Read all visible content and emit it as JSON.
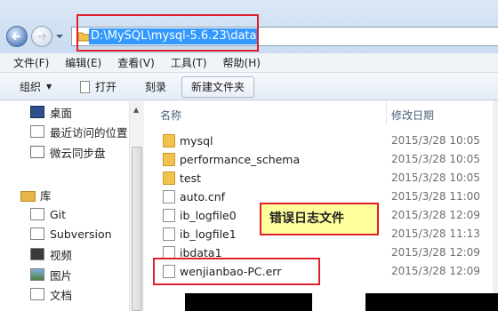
{
  "address": {
    "path": "D:\\MySQL\\mysql-5.6.23\\data"
  },
  "menu": [
    "文件(F)",
    "编辑(E)",
    "查看(V)",
    "工具(T)",
    "帮助(H)"
  ],
  "toolbar": {
    "organize": "组织",
    "open": "打开",
    "burn": "刻录",
    "new_folder": "新建文件夹"
  },
  "nav": {
    "favorites": [
      {
        "label": "桌面",
        "icon": "desktop-icon"
      },
      {
        "label": "最近访问的位置",
        "icon": "recent-places-icon"
      },
      {
        "label": "微云同步盘",
        "icon": "weiyun-sync-icon"
      }
    ],
    "libraries_label": "库",
    "libraries": [
      {
        "label": "Git",
        "icon": "git-library-icon"
      },
      {
        "label": "Subversion",
        "icon": "svn-library-icon"
      },
      {
        "label": "视频",
        "icon": "video-library-icon"
      },
      {
        "label": "图片",
        "icon": "picture-library-icon"
      },
      {
        "label": "文档",
        "icon": "document-library-icon"
      }
    ]
  },
  "columns": {
    "name": "名称",
    "modified": "修改日期"
  },
  "files": [
    {
      "name": "mysql",
      "date": "2015/3/28 10:05",
      "kind": "folder"
    },
    {
      "name": "performance_schema",
      "date": "2015/3/28 10:05",
      "kind": "folder"
    },
    {
      "name": "test",
      "date": "2015/3/28 10:05",
      "kind": "folder"
    },
    {
      "name": "auto.cnf",
      "date": "2015/3/28 11:00",
      "kind": "config"
    },
    {
      "name": "ib_logfile0",
      "date": "2015/3/28 12:09",
      "kind": "file"
    },
    {
      "name": "ib_logfile1",
      "date": "2015/3/28 11:13",
      "kind": "file"
    },
    {
      "name": "ibdata1",
      "date": "2015/3/28 12:09",
      "kind": "file"
    },
    {
      "name": "wenjianbao-PC.err",
      "date": "2015/3/28 12:09",
      "kind": "file"
    }
  ],
  "annotation": {
    "label": "错误日志文件"
  },
  "colors": {
    "annotation_red": "#e0202a",
    "callout_bg": "#ffff9e",
    "selection": "#3399ff"
  }
}
